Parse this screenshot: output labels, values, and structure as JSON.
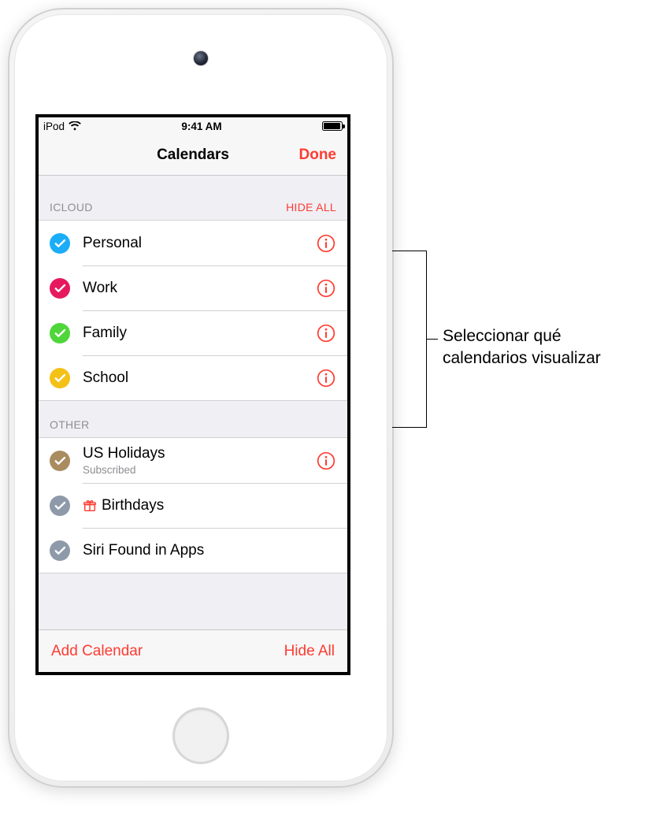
{
  "status": {
    "device": "iPod",
    "time": "9:41 AM"
  },
  "nav": {
    "title": "Calendars",
    "done": "Done"
  },
  "sections": {
    "icloud": {
      "header": "ICLOUD",
      "hide": "HIDE ALL",
      "items": [
        {
          "label": "Personal",
          "color": "#1badf8"
        },
        {
          "label": "Work",
          "color": "#e6185e"
        },
        {
          "label": "Family",
          "color": "#4fd63a"
        },
        {
          "label": "School",
          "color": "#f4c217"
        }
      ]
    },
    "other": {
      "header": "OTHER",
      "items": [
        {
          "label": "US Holidays",
          "sub": "Subscribed",
          "color": "#a98c5f",
          "info": true
        },
        {
          "label": "Birthdays",
          "color": "#8e9aa9",
          "gift": true
        },
        {
          "label": "Siri Found in Apps",
          "color": "#8e9aa9"
        }
      ]
    }
  },
  "toolbar": {
    "add": "Add Calendar",
    "hide": "Hide All"
  },
  "callout": {
    "text": "Seleccionar qué calendarios visualizar"
  },
  "colors": {
    "accent": "#ff3b30"
  }
}
